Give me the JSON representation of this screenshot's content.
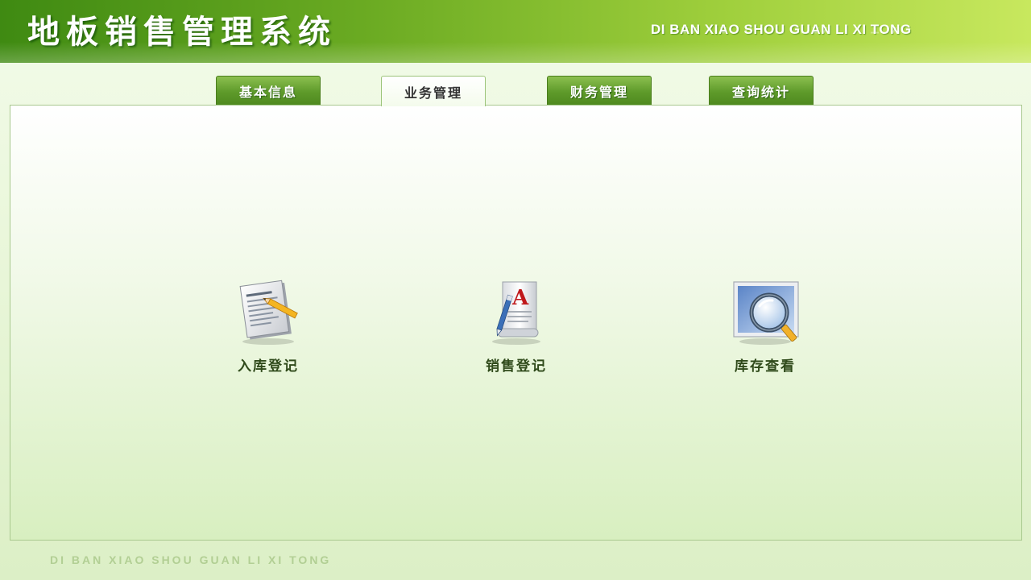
{
  "header": {
    "title": "地板销售管理系统",
    "subtitle_en": "DI BAN XIAO SHOU GUAN LI XI TONG"
  },
  "tabs": [
    {
      "label": "基本信息",
      "active": false
    },
    {
      "label": "业务管理",
      "active": true
    },
    {
      "label": "财务管理",
      "active": false
    },
    {
      "label": "查询统计",
      "active": false
    }
  ],
  "functions": [
    {
      "label": "入库登记",
      "icon": "document-pencil-icon"
    },
    {
      "label": "销售登记",
      "icon": "font-document-pen-icon"
    },
    {
      "label": "库存查看",
      "icon": "magnifier-monitor-icon"
    }
  ],
  "footer": {
    "text_en": "DI BAN XIAO SHOU GUAN LI XI TONG"
  },
  "colors": {
    "header_dark": "#3f8a12",
    "header_light": "#c8e85e",
    "tab_green": "#5e9a2a",
    "label_text": "#2f4a1a"
  }
}
